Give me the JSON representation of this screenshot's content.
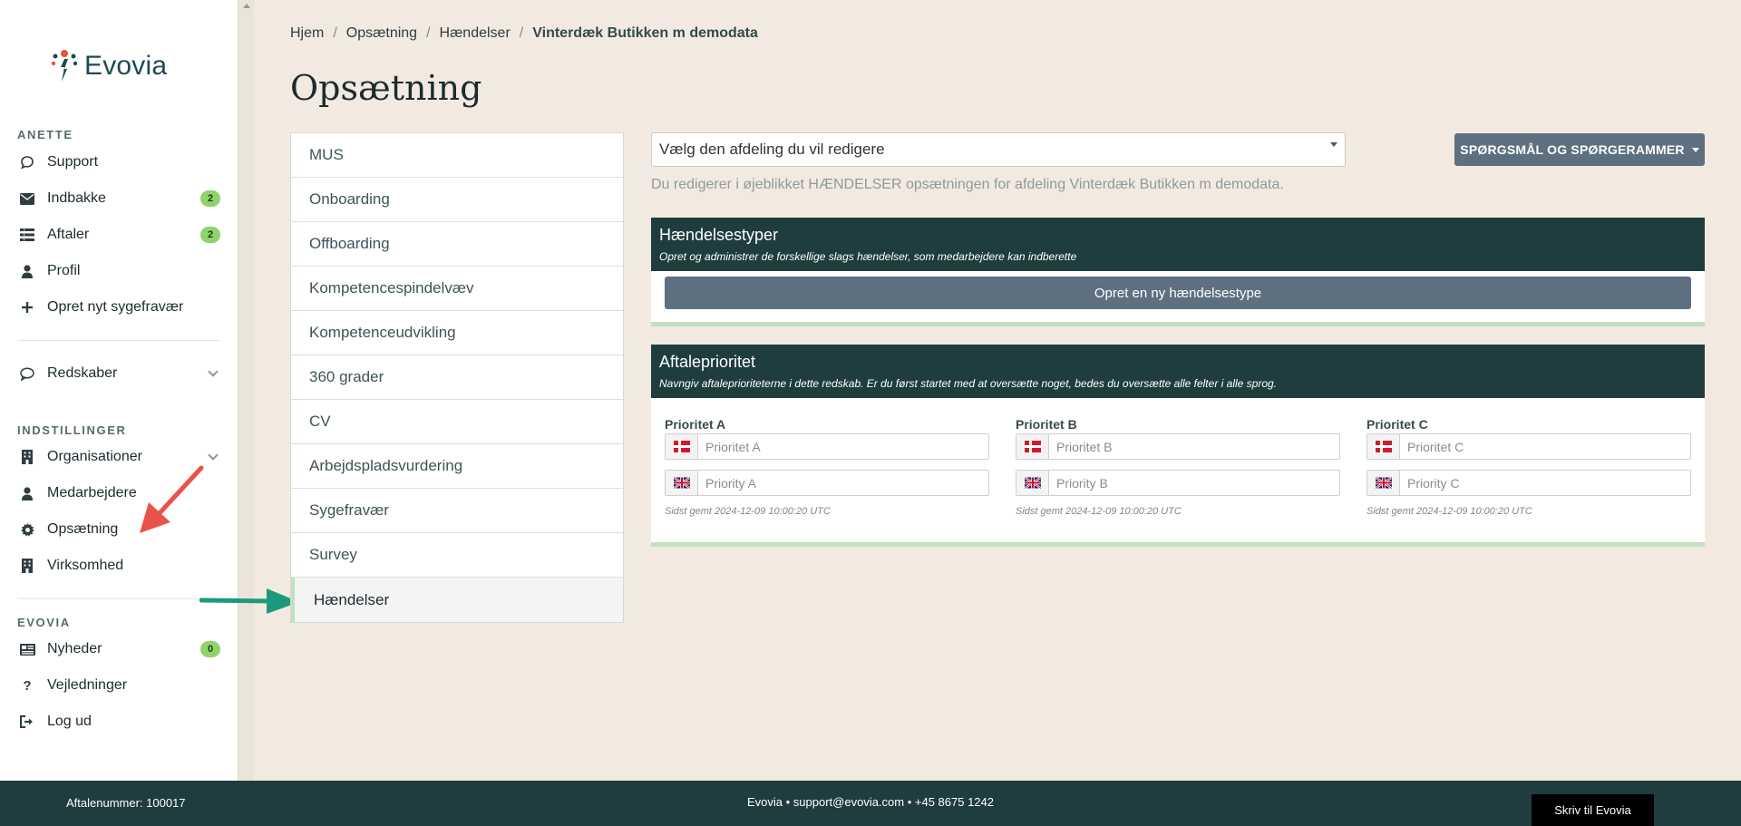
{
  "sidebar": {
    "logo_text": "Evovia",
    "section_user": "ANETTE",
    "user_items": [
      {
        "label": "Support",
        "icon": "chat-bubble-icon"
      },
      {
        "label": "Indbakke",
        "icon": "envelope-icon",
        "badge": "2"
      },
      {
        "label": "Aftaler",
        "icon": "list-icon",
        "badge": "2"
      },
      {
        "label": "Profil",
        "icon": "user-icon"
      },
      {
        "label": "Opret nyt sygefravær",
        "icon": "plus-icon"
      }
    ],
    "tools_item": {
      "label": "Redskaber",
      "icon": "comment-icon"
    },
    "section_settings": "INDSTILLINGER",
    "settings_items": [
      {
        "label": "Organisationer",
        "icon": "building-icon"
      },
      {
        "label": "Medarbejdere",
        "icon": "user-icon"
      },
      {
        "label": "Opsætning",
        "icon": "gear-icon"
      },
      {
        "label": "Virksomhed",
        "icon": "building-icon"
      }
    ],
    "section_evovia": "EVOVIA",
    "evovia_items": [
      {
        "label": "Nyheder",
        "icon": "newspaper-icon",
        "badge": "0"
      },
      {
        "label": "Vejledninger",
        "icon": "question-icon"
      },
      {
        "label": "Log ud",
        "icon": "sign-out-icon"
      }
    ]
  },
  "breadcrumb": {
    "items": [
      "Hjem",
      "Opsætning",
      "Hændelser"
    ],
    "current": "Vinterdæk Butikken m demodata"
  },
  "page_title": "Opsætning",
  "settings_menu": [
    "MUS",
    "Onboarding",
    "Offboarding",
    "Kompetencespindelvæv",
    "Kompetenceudvikling",
    "360 grader",
    "CV",
    "Arbejdspladsvurdering",
    "Sygefravær",
    "Survey",
    "Hændelser"
  ],
  "department_select": {
    "value": "Vælg den afdeling du vil redigere"
  },
  "info_text": "Du redigerer i øjeblikket HÆNDELSER opsætningen for afdeling Vinterdæk Butikken m demodata.",
  "top_button": "SPØRGSMÅL OG SPØRGERAMMER",
  "event_types": {
    "title": "Hændelsestyper",
    "subtitle": "Opret og administrer de forskellige slags hændelser, som medarbejdere kan indberette",
    "create_button": "Opret en ny hændelsestype"
  },
  "agreement_priority": {
    "title": "Aftaleprioritet",
    "subtitle": "Navngiv aftaleprioriteterne i dette redskab. Er du først startet med at oversætte noget, bedes du oversætte alle felter i alle sprog.",
    "columns": [
      {
        "label": "Prioritet A",
        "da_placeholder": "Prioritet A",
        "en_placeholder": "Priority A",
        "saved": "Sidst gemt 2024-12-09 10:00:20 UTC"
      },
      {
        "label": "Prioritet B",
        "da_placeholder": "Prioritet B",
        "en_placeholder": "Priority B",
        "saved": "Sidst gemt 2024-12-09 10:00:20 UTC"
      },
      {
        "label": "Prioritet C",
        "da_placeholder": "Prioritet C",
        "en_placeholder": "Priority C",
        "saved": "Sidst gemt 2024-12-09 10:00:20 UTC"
      }
    ]
  },
  "footer": {
    "agreement": "Aftalenummer: 100017",
    "contact": "Evovia • support@evovia.com • +45 8675 1242",
    "write_button": "Skriv til Evovia"
  },
  "colors": {
    "header_dark": "#1f3d3f",
    "button_slate": "#5e7080",
    "accent_green": "#c4e0bf",
    "badge_green": "#8fd36b",
    "background": "#f2eae0"
  }
}
